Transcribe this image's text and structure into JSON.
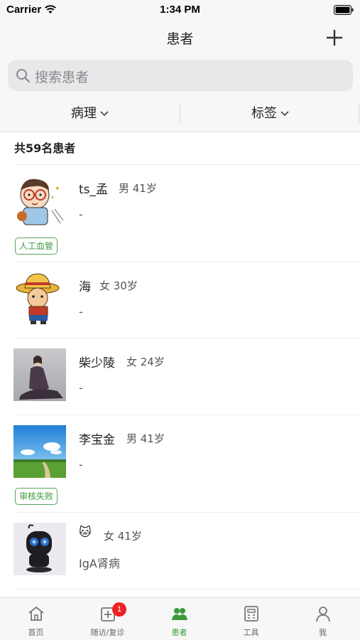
{
  "status_bar": {
    "carrier": "Carrier",
    "time": "1:34 PM"
  },
  "nav": {
    "title": "患者"
  },
  "search": {
    "placeholder": "搜索患者"
  },
  "filters": {
    "left_label": "病理",
    "right_label": "标签"
  },
  "summary": {
    "count_text": "共59名患者"
  },
  "patients": [
    {
      "name": "ts_孟",
      "info": "男 41岁",
      "diagnosis": "-",
      "tag": "人工血管"
    },
    {
      "name": "海",
      "info": "女 30岁",
      "diagnosis": "-",
      "tag": ""
    },
    {
      "name": "柴少陵",
      "info": "女 24岁",
      "diagnosis": "-",
      "tag": ""
    },
    {
      "name": "李宝金",
      "info": "男 41岁",
      "diagnosis": "-",
      "tag": "审核失败"
    },
    {
      "name": "🐱",
      "info": "女 41岁",
      "diagnosis": "IgA肾病",
      "tag": ""
    }
  ],
  "tabs": [
    {
      "label": "首页",
      "icon": "home-icon"
    },
    {
      "label": "随访/复诊",
      "icon": "followup-icon",
      "badge": "1"
    },
    {
      "label": "患者",
      "icon": "patients-icon",
      "active": true
    },
    {
      "label": "工具",
      "icon": "tools-icon"
    },
    {
      "label": "我",
      "icon": "profile-icon"
    }
  ],
  "colors": {
    "accent": "#3a9a3a",
    "badge": "#ee2222",
    "tag_border": "#5aa55a"
  }
}
